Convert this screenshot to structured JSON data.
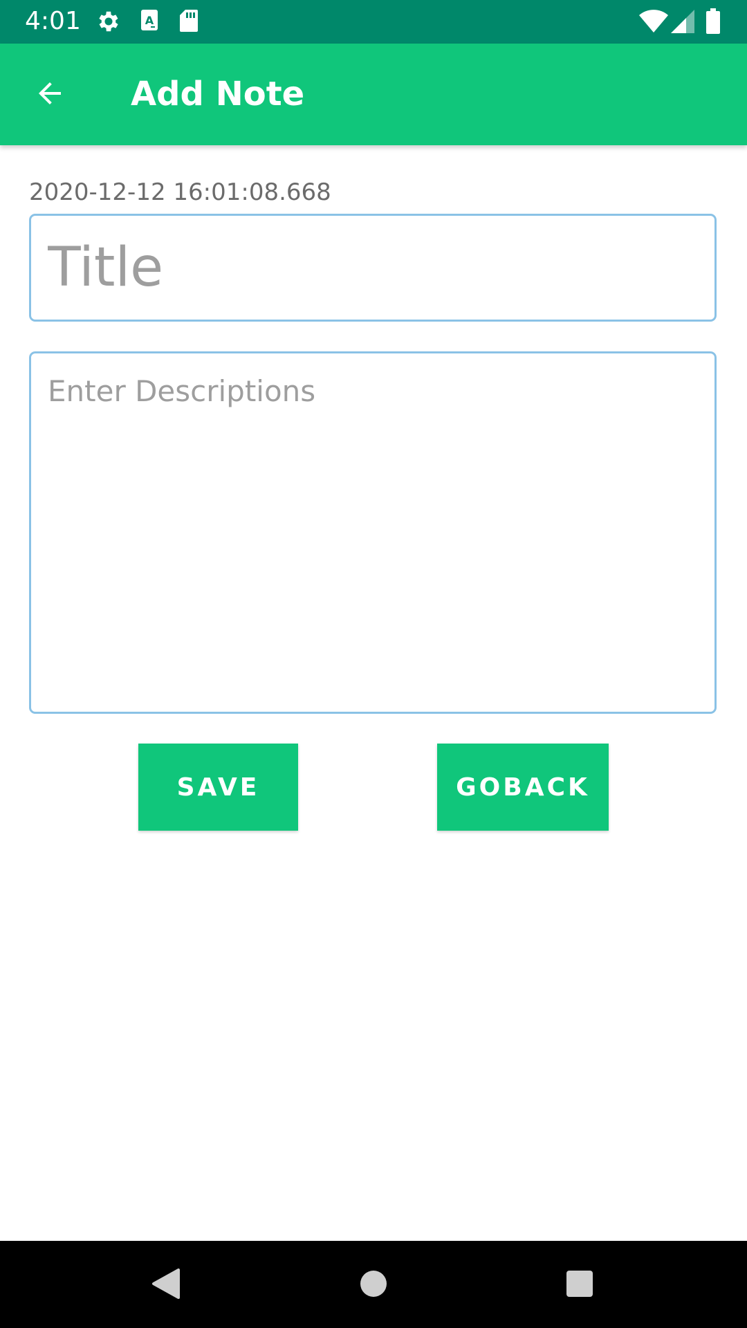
{
  "status_bar": {
    "time": "4:01",
    "icons_left": [
      "gear-icon",
      "text-a-icon",
      "sd-card-icon"
    ],
    "icons_right": [
      "wifi-icon",
      "signal-icon",
      "battery-icon"
    ]
  },
  "app_bar": {
    "title": "Add Note",
    "back_icon": "arrow-back-icon",
    "color": "#10C67B"
  },
  "note": {
    "timestamp": "2020-12-12 16:01:08.668",
    "title_placeholder": "Title",
    "title_value": "",
    "description_placeholder": "Enter Descriptions",
    "description_value": ""
  },
  "actions": {
    "save_label": "SAVE",
    "goback_label": "GOBACK"
  },
  "nav_bar": {
    "buttons": [
      "back-triangle-icon",
      "home-circle-icon",
      "recents-square-icon"
    ]
  },
  "colors": {
    "status_bar": "#00886A",
    "accent": "#10C67B",
    "field_border": "#8AC2E6"
  }
}
